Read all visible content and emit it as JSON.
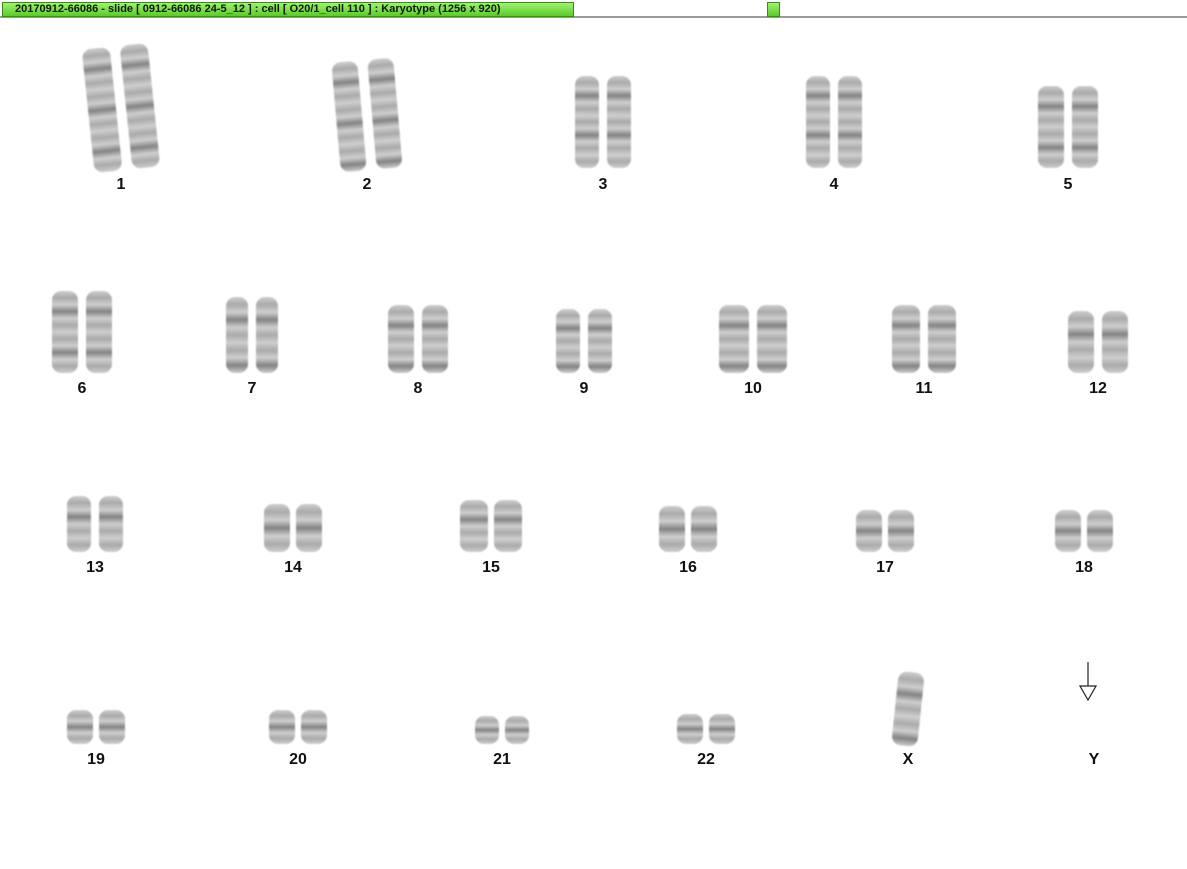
{
  "window": {
    "title": "20170912-66086 - slide [ 0912-66086 24-5_12 ] : cell [ O20/1_cell 110 ] : Karyotype  (1256 x 920)"
  },
  "karyotype": {
    "chromosomes": [
      {
        "label": "1"
      },
      {
        "label": "2"
      },
      {
        "label": "3"
      },
      {
        "label": "4"
      },
      {
        "label": "5"
      },
      {
        "label": "6"
      },
      {
        "label": "7"
      },
      {
        "label": "8"
      },
      {
        "label": "9"
      },
      {
        "label": "10"
      },
      {
        "label": "11"
      },
      {
        "label": "12"
      },
      {
        "label": "13"
      },
      {
        "label": "14"
      },
      {
        "label": "15"
      },
      {
        "label": "16"
      },
      {
        "label": "17"
      },
      {
        "label": "18"
      },
      {
        "label": "19"
      },
      {
        "label": "20"
      },
      {
        "label": "21"
      },
      {
        "label": "22"
      },
      {
        "label": "X"
      },
      {
        "label": "Y"
      }
    ]
  },
  "icons": {
    "y_marker": "down-arrow-icon"
  },
  "colors": {
    "title_green": "#5cc92d",
    "chromosome_gray": "#8a8a8a"
  }
}
